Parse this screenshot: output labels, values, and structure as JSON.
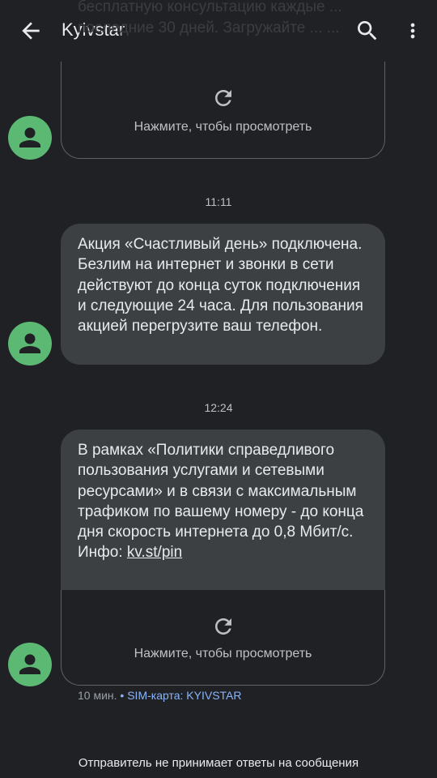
{
  "header": {
    "title": "Kyivstar",
    "obscured_text": "бесплатную консультацию каждые ... последние 30 дней. Загружайте ... ..."
  },
  "messages": [
    {
      "id": "msg1",
      "mms_hint": "Нажмите, чтобы просмотреть"
    },
    {
      "id": "msg2",
      "timestamp": "11:11",
      "text": "Акция «Счастливый день» подключена. Безлим на интернет и звонки в сети действуют до конца суток подключения и следующие 24 часа. Для пользования акцией перегрузите ваш телефон."
    },
    {
      "id": "msg3",
      "timestamp": "12:24",
      "text_main": "В рамках «Политики справедливого пользования услугами и сетевыми ресурсами» и в связи с максимальным трафиком по вашему номеру - до конца дня скорость интернета до 0,8 Мбит/с. Инфо: ",
      "link": "kv.st/pin",
      "mms_hint": "Нажмите, чтобы просмотреть",
      "meta_time": "10 мин.",
      "meta_sep": " • ",
      "meta_sim": "SIM-карта: KYIVSTAR"
    }
  ],
  "footer": "Отправитель не принимает ответы на сообщения",
  "colors": {
    "background": "#202124",
    "bubble": "#3c4043",
    "avatar": "#5bb974",
    "sim_label": "#8ab4f8"
  },
  "icons": [
    "back-arrow-icon",
    "search-icon",
    "more-vert-icon",
    "person-icon",
    "refresh-icon"
  ]
}
